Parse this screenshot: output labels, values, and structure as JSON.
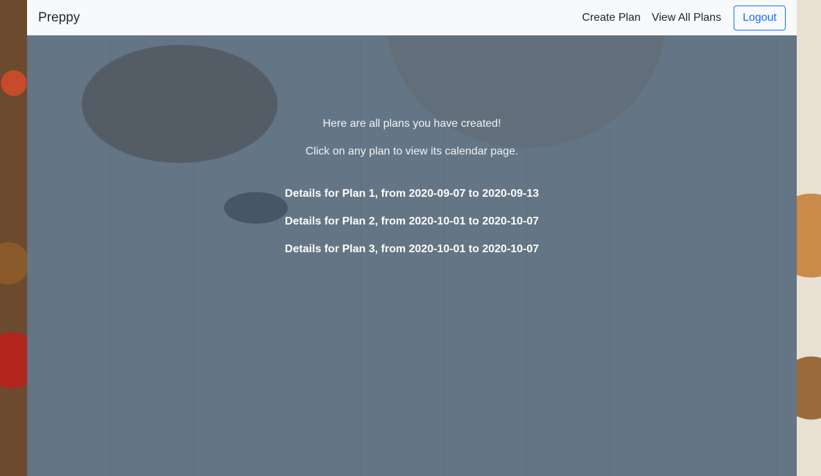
{
  "navbar": {
    "brand": "Preppy",
    "links": [
      "Create Plan",
      "View All Plans"
    ],
    "logout_label": "Logout"
  },
  "main": {
    "intro": "Here are all plans you have created!",
    "instruction": "Click on any plan to view its calendar page.",
    "plans": [
      "Details for Plan 1, from 2020-09-07 to 2020-09-13",
      "Details for Plan 2, from 2020-10-01 to 2020-10-07",
      "Details for Plan 3, from 2020-10-01 to 2020-10-07"
    ]
  },
  "colors": {
    "navbar_bg": "#f8f9fa",
    "accent": "#0d6efd",
    "overlay": "#495c6e"
  }
}
